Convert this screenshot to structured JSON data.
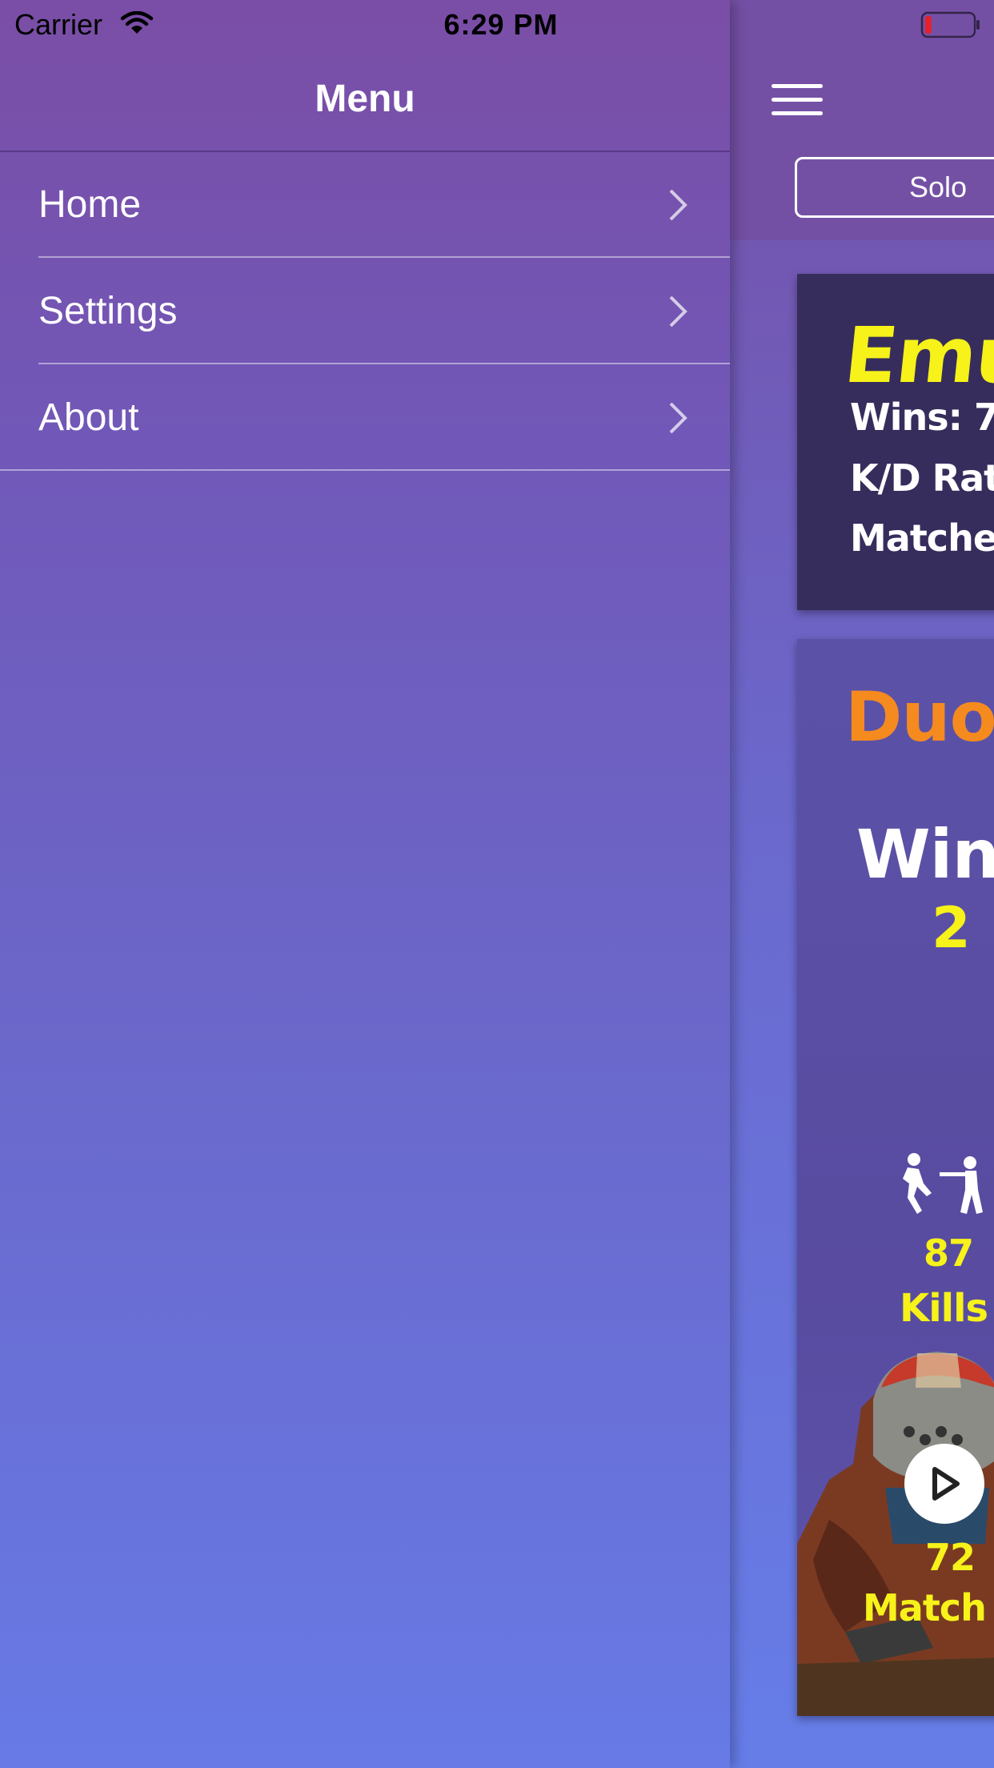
{
  "status_bar": {
    "carrier": "Carrier",
    "time": "6:29 PM",
    "wifi_icon": "wifi-icon",
    "battery_icon": "battery-low-icon",
    "battery_level_fraction": 0.1
  },
  "menu": {
    "title": "Menu",
    "items": [
      {
        "label": "Home",
        "icon": "chevron-right-icon"
      },
      {
        "label": "Settings",
        "icon": "chevron-right-icon"
      },
      {
        "label": "About",
        "icon": "chevron-right-icon"
      }
    ]
  },
  "main": {
    "hamburger_icon": "hamburger-menu-icon",
    "segment_label": "Solo",
    "solo_card": {
      "name": "Emu",
      "wins": "Wins: 7",
      "kd": "K/D Rat",
      "matches": "Matche"
    },
    "duo_card": {
      "title": "Duo",
      "wins_label": "Wins",
      "wins_value": "2",
      "kills_icon": "kill-icon",
      "kills_value": "87",
      "kills_label": "Kills",
      "play_icon": "play-icon",
      "matches_value": "72",
      "matches_label": "Match"
    }
  },
  "colors": {
    "accent_yellow": "#f6f21a",
    "accent_orange": "#f58a1f",
    "header_purple": "#7450a5",
    "solo_card_bg": "#372d5c"
  }
}
